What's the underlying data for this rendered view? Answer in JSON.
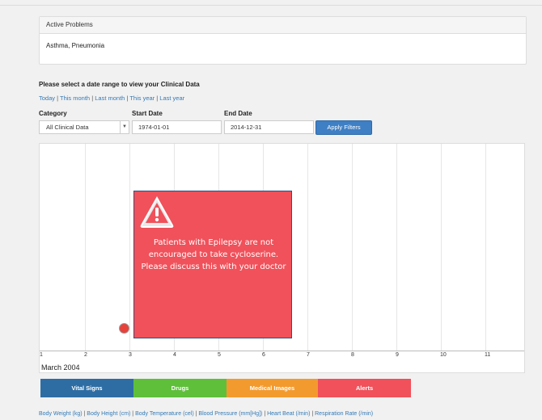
{
  "problems": {
    "title": "Active Problems",
    "list": "Asthma, Pneumonia"
  },
  "filter": {
    "prompt": "Please select a date range to view your Clinical Data",
    "quick_links": [
      "Today",
      "This month",
      "Last month",
      "This year",
      "Last year"
    ],
    "category_label": "Category",
    "category_value": "All Clinical Data",
    "start_label": "Start Date",
    "start_value": "1974-01-01",
    "end_label": "End Date",
    "end_value": "2014-12-31",
    "apply_label": "Apply Filters"
  },
  "timeline": {
    "ticks": [
      "1",
      "2",
      "3",
      "4",
      "5",
      "6",
      "7",
      "8",
      "9",
      "10",
      "11"
    ],
    "month_label": "March 2004",
    "alert_text": "Patients with Epilepsy are not encouraged to take cycloserine. Please discuss this with your doctor",
    "alert_icon": "warning-icon",
    "alert_color": "#f0515a"
  },
  "legend": [
    {
      "label": "Vital Signs",
      "color": "#2e6da4"
    },
    {
      "label": "Drugs",
      "color": "#5fbf3a"
    },
    {
      "label": "Medical Images",
      "color": "#f39a2e"
    },
    {
      "label": "Alerts",
      "color": "#f0515a"
    }
  ],
  "vital_links": [
    "Body Weight (kg)",
    "Body Height (cm)",
    "Body Temperature (cel)",
    "Blood Pressure (mm[Hg])",
    "Heart Beat (/min)",
    "Respiration Rate (/min)"
  ]
}
